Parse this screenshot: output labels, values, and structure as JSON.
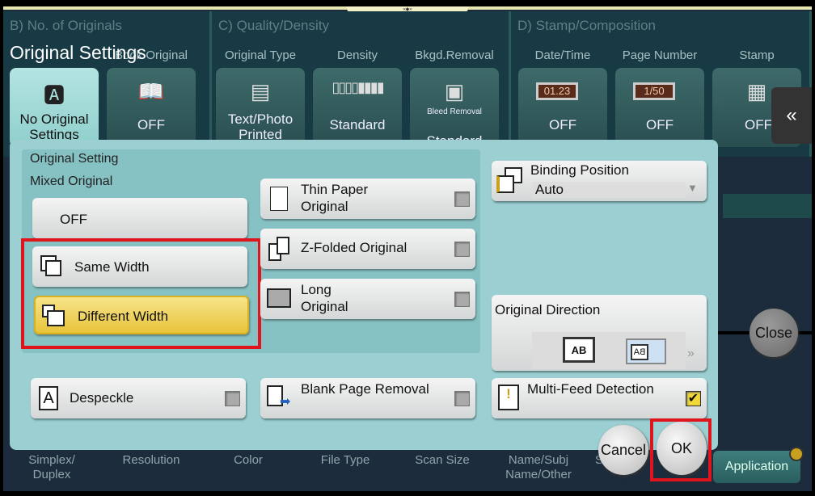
{
  "header": {
    "handle": "«◆»",
    "groups": {
      "b": "B)   No. of Originals",
      "c": "C)   Quality/Density",
      "d": "D)   Stamp/Composition"
    },
    "popup_title": "Original Settings"
  },
  "tiles": [
    {
      "label": "",
      "value": "No Original Settings",
      "icon": "document-a-icon"
    },
    {
      "label": "Book Original",
      "value": "OFF",
      "icon": "book-icon"
    },
    {
      "label": "Original Type",
      "value": "Text/Photo Printed",
      "icon": "text-photo-icon"
    },
    {
      "label": "Density",
      "value": "Standard",
      "icon": "density-scale-icon"
    },
    {
      "label": "Bkgd.Removal",
      "sub": "Bleed Removal",
      "value": "Standard",
      "icon": "bleed-removal-icon"
    },
    {
      "label": "Date/Time",
      "value": "OFF",
      "icon_text": "01.23",
      "icon": "date-stamp-icon"
    },
    {
      "label": "Page Number",
      "value": "OFF",
      "icon_text": "1/50",
      "icon": "page-number-icon"
    },
    {
      "label": "Stamp",
      "value": "OFF",
      "icon": "stamp-icon"
    }
  ],
  "panel": {
    "section_title": "Original Setting",
    "mixed_label": "Mixed Original",
    "mixed_options": [
      {
        "label": "OFF",
        "selected": false
      },
      {
        "label": "Same Width",
        "selected": false
      },
      {
        "label": "Different Width",
        "selected": true
      }
    ],
    "thin_paper": {
      "label": "Thin Paper Original",
      "checked": false
    },
    "z_folded": {
      "label": "Z-Folded Original",
      "checked": false
    },
    "long_original": {
      "label": "Long Original",
      "checked": false
    },
    "binding": {
      "label": "Binding Position",
      "value": "Auto"
    },
    "direction": {
      "label": "Original Direction",
      "ab": "AB",
      "ba": "BA"
    },
    "despeckle": {
      "label": "Despeckle",
      "checked": false
    },
    "blank_page": {
      "label": "Blank Page Removal",
      "checked": false
    },
    "multi_feed": {
      "label": "Multi-Feed Detection",
      "checked": true
    }
  },
  "actions": {
    "cancel": "Cancel",
    "ok": "OK",
    "close": "Close",
    "application": "Application"
  },
  "bottom_tabs": [
    "Simplex/ Duplex",
    "Resolution",
    "Color",
    "File Type",
    "Scan Size",
    "Name/Subj Name/Other",
    "S"
  ],
  "colors": {
    "highlight": "#e0141c",
    "selected": "#f2d95a",
    "panel": "#9bcfd2"
  }
}
